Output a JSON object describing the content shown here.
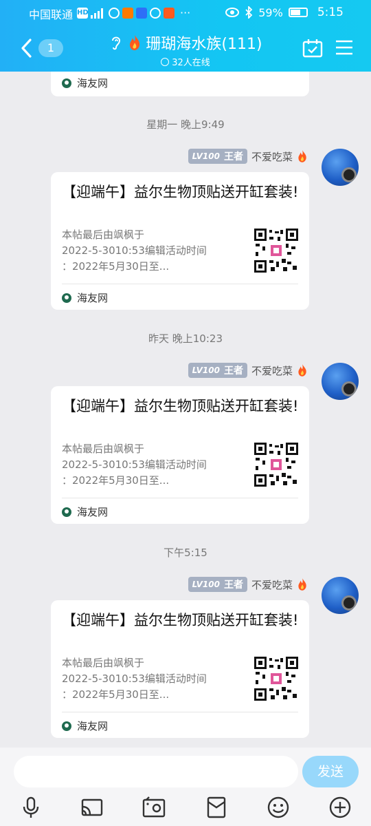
{
  "status_bar": {
    "carrier": "中国联通",
    "hd": "HD",
    "battery": "59%",
    "time": "5:15",
    "more": "···"
  },
  "header": {
    "unread_count": "1",
    "title": "珊瑚海水族(111)",
    "online": "32人在线"
  },
  "top_card": {
    "source": "海友网"
  },
  "messages": [
    {
      "timestamp": "星期一 晚上9:49",
      "level": "LV100",
      "rank": "王者",
      "sender": "不爱吃菜",
      "title": "【迎端午】益尔生物顶贴送开缸套装!",
      "desc_lines": [
        "本帖最后由飒枫于",
        "2022-5-3010:53编辑活动时间",
        "：2022年5月30日至..."
      ],
      "source": "海友网"
    },
    {
      "timestamp": "昨天 晚上10:23",
      "level": "LV100",
      "rank": "王者",
      "sender": "不爱吃菜",
      "title": "【迎端午】益尔生物顶贴送开缸套装!",
      "desc_lines": [
        "本帖最后由飒枫于",
        "2022-5-3010:53编辑活动时间",
        "：2022年5月30日至..."
      ],
      "source": "海友网"
    },
    {
      "timestamp": "下午5:15",
      "level": "LV100",
      "rank": "王者",
      "sender": "不爱吃菜",
      "title": "【迎端午】益尔生物顶贴送开缸套装!",
      "desc_lines": [
        "本帖最后由飒枫于",
        "2022-5-3010:53编辑活动时间",
        "：2022年5月30日至..."
      ],
      "source": "海友网"
    }
  ],
  "input": {
    "value": "",
    "send_label": "发送"
  },
  "toolbar": {
    "icons": [
      "microphone-icon",
      "screen-share-icon",
      "image-icon",
      "red-packet-icon",
      "emoji-icon",
      "plus-icon"
    ]
  },
  "colors": {
    "header_start": "#22b0f6",
    "header_end": "#15c9f1",
    "send_button": "#98d8fb",
    "background": "#ececef"
  }
}
